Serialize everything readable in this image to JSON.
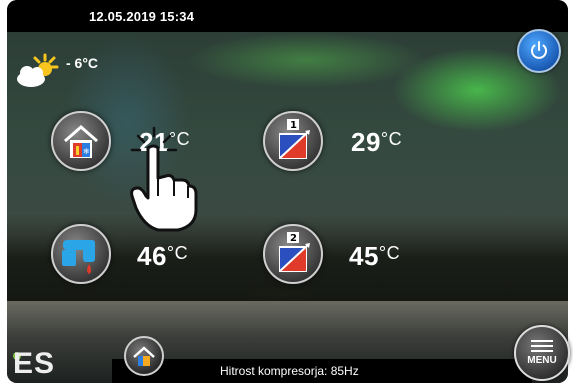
{
  "header": {
    "datetime": "12.05.2019  15:34"
  },
  "weather": {
    "icon": "partly-sunny-icon",
    "outside_temp": "- 6°C"
  },
  "tiles": [
    {
      "name": "room-heating",
      "icon": "house-heating-cooling-icon",
      "value": "21",
      "unit": "°C"
    },
    {
      "name": "circuit-1",
      "icon": "heating-curve-1-icon",
      "badge": "1",
      "value": "29",
      "unit": "°C"
    },
    {
      "name": "hot-water",
      "icon": "tap-water-icon",
      "value": "46",
      "unit": "°C"
    },
    {
      "name": "circuit-2",
      "icon": "heating-curve-2-icon",
      "badge": "2",
      "value": "45",
      "unit": "°C"
    }
  ],
  "status": {
    "text": "Hitrost kompresorja: 85Hz"
  },
  "logo": {
    "text": "ES"
  },
  "menu": {
    "label": "MENU"
  },
  "colors": {
    "accent_blue": "#2b7de0",
    "logo_green": "#7fc241",
    "bar": "#000000"
  }
}
